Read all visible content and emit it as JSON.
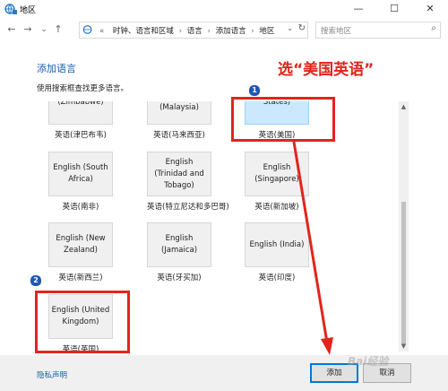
{
  "window": {
    "title": "地区",
    "minimize": "—",
    "maximize": "☐",
    "close": "✕"
  },
  "nav": {
    "back": "←",
    "forward": "→",
    "dropdown": "⌄",
    "up": "↑",
    "overflow": "«"
  },
  "breadcrumbs": [
    "时钟、语言和区域",
    "语言",
    "添加语言",
    "地区"
  ],
  "breadcrumb_separator": "›",
  "search": {
    "placeholder": "搜索地区"
  },
  "page": {
    "heading": "添加语言",
    "subtitle": "使用搜索框查找更多语言。"
  },
  "annotation": "选“美国英语”",
  "badges": [
    "1",
    "2"
  ],
  "tiles": [
    {
      "name": "(Zimbabwe)",
      "label": "英语(津巴布韦)"
    },
    {
      "name": "English (Malaysia)",
      "label": "英语(马来西亚)"
    },
    {
      "name": "States)",
      "label": "英语(美国)",
      "selected": true
    },
    {
      "name": "English (South Africa)",
      "label": "英语(南非)"
    },
    {
      "name": "English (Trinidad and Tobago)",
      "label": "英语(特立尼达和多巴哥)"
    },
    {
      "name": "English (Singapore)",
      "label": "英语(新加坡)"
    },
    {
      "name": "English (New Zealand)",
      "label": "英语(新西兰)"
    },
    {
      "name": "English (Jamaica)",
      "label": "英语(牙买加)"
    },
    {
      "name": "English (India)",
      "label": "英语(印度)"
    },
    {
      "name": "English (United Kingdom)",
      "label": "英语(英国)"
    }
  ],
  "footer": {
    "privacy": "隐私声明",
    "add": "添加",
    "cancel": "取消"
  },
  "watermark": "Bai经验",
  "colors": {
    "accent": "#1a5fa8",
    "annotation": "#e1251b",
    "selected": "#cce8ff"
  }
}
